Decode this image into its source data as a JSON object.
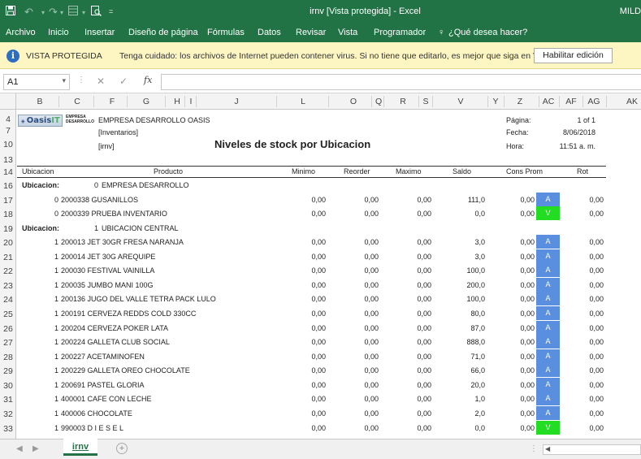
{
  "titlebar": {
    "title": "irnv  [Vista protegida]  -  Excel",
    "user": "MILD",
    "save_icon": "save-icon",
    "undo_icon": "undo-icon",
    "redo_icon": "redo-icon",
    "preview_icon": "print-preview-icon",
    "customize_icon": "customize-qat-icon"
  },
  "ribbon": {
    "tabs": [
      "Archivo",
      "Inicio",
      "Insertar",
      "Diseño de página",
      "Fórmulas",
      "Datos",
      "Revisar",
      "Vista",
      "Programador",
      "¿Qué desea hacer?"
    ]
  },
  "protected_view": {
    "label": "VISTA PROTEGIDA",
    "message": "Tenga cuidado: los archivos de Internet pueden contener virus. Si no tiene que editarlo, es mejor que siga en Vista protegida.",
    "button": "Habilitar edición",
    "icon": "info-icon"
  },
  "formula_bar": {
    "name_box": "A1",
    "fx": "fx",
    "cancel": "✕",
    "enter": "✓",
    "formula": ""
  },
  "columns": [
    "B",
    "C",
    "F",
    "G",
    "H",
    "I",
    "J",
    "L",
    "O",
    "Q",
    "R",
    "S",
    "V",
    "Y",
    "Z",
    "AC",
    "AF",
    "AG",
    "AK"
  ],
  "rows": [
    "4",
    "7",
    "10",
    "13",
    "14",
    "16",
    "17",
    "18",
    "19",
    "20",
    "21",
    "22",
    "23",
    "24",
    "25",
    "26",
    "27",
    "28",
    "29",
    "30",
    "31",
    "32",
    "33"
  ],
  "report": {
    "logo_text": "OasisIT",
    "logo_sub": "EMPRESA DESARROLLO",
    "company": "EMPRESA DESARROLLO OASIS",
    "line2": "[Inventarios]",
    "line3": "[irnv]",
    "title": "Niveles de stock por Ubicacion",
    "pagina_label": "Página:",
    "pagina_value": "1 of 1",
    "fecha_label": "Fecha:",
    "fecha_value": "8/06/2018",
    "hora_label": "Hora:",
    "hora_value": "11:51 a. m.",
    "headers": {
      "ubicacion": "Ubicacion",
      "producto": "Producto",
      "minimo": "Minimo",
      "reorder": "Reorder",
      "maximo": "Maximo",
      "saldo": "Saldo",
      "cons_prom": "Cons Prom",
      "rot": "Rot"
    },
    "group_label": "Ubicacion:",
    "groups": [
      {
        "code": "0",
        "name": "EMPRESA DESARROLLO"
      },
      {
        "code": "1",
        "name": "UBICACION CENTRAL"
      }
    ],
    "items": [
      {
        "loc": "0",
        "producto": "2000338 GUSANILLOS",
        "minimo": "0,00",
        "reorder": "0,00",
        "maximo": "0,00",
        "saldo": "111,0",
        "cons": "0,00",
        "flag": "A",
        "rot": "0,00"
      },
      {
        "loc": "0",
        "producto": "2000339 PRUEBA INVENTARIO",
        "minimo": "0,00",
        "reorder": "0,00",
        "maximo": "0,00",
        "saldo": "0,0",
        "cons": "0,00",
        "flag": "V",
        "rot": "0,00"
      },
      {
        "loc": "1",
        "producto": "200013 JET 30GR FRESA NARANJA",
        "minimo": "0,00",
        "reorder": "0,00",
        "maximo": "0,00",
        "saldo": "3,0",
        "cons": "0,00",
        "flag": "A",
        "rot": "0,00"
      },
      {
        "loc": "1",
        "producto": "200014 JET 30G AREQUIPE",
        "minimo": "0,00",
        "reorder": "0,00",
        "maximo": "0,00",
        "saldo": "3,0",
        "cons": "0,00",
        "flag": "A",
        "rot": "0,00"
      },
      {
        "loc": "1",
        "producto": "200030 FESTIVAL VAINILLA",
        "minimo": "0,00",
        "reorder": "0,00",
        "maximo": "0,00",
        "saldo": "100,0",
        "cons": "0,00",
        "flag": "A",
        "rot": "0,00"
      },
      {
        "loc": "1",
        "producto": "200035 JUMBO MANI 100G",
        "minimo": "0,00",
        "reorder": "0,00",
        "maximo": "0,00",
        "saldo": "200,0",
        "cons": "0,00",
        "flag": "A",
        "rot": "0,00"
      },
      {
        "loc": "1",
        "producto": "200136 JUGO DEL VALLE TETRA PACK LULO",
        "minimo": "0,00",
        "reorder": "0,00",
        "maximo": "0,00",
        "saldo": "100,0",
        "cons": "0,00",
        "flag": "A",
        "rot": "0,00"
      },
      {
        "loc": "1",
        "producto": "200191 CERVEZA REDDS COLD 330CC",
        "minimo": "0,00",
        "reorder": "0,00",
        "maximo": "0,00",
        "saldo": "80,0",
        "cons": "0,00",
        "flag": "A",
        "rot": "0,00"
      },
      {
        "loc": "1",
        "producto": "200204 CERVEZA POKER LATA",
        "minimo": "0,00",
        "reorder": "0,00",
        "maximo": "0,00",
        "saldo": "87,0",
        "cons": "0,00",
        "flag": "A",
        "rot": "0,00"
      },
      {
        "loc": "1",
        "producto": "200224 GALLETA CLUB SOCIAL",
        "minimo": "0,00",
        "reorder": "0,00",
        "maximo": "0,00",
        "saldo": "888,0",
        "cons": "0,00",
        "flag": "A",
        "rot": "0,00"
      },
      {
        "loc": "1",
        "producto": "200227 ACETAMINOFEN",
        "minimo": "0,00",
        "reorder": "0,00",
        "maximo": "0,00",
        "saldo": "71,0",
        "cons": "0,00",
        "flag": "A",
        "rot": "0,00"
      },
      {
        "loc": "1",
        "producto": "200229 GALLETA OREO CHOCOLATE",
        "minimo": "0,00",
        "reorder": "0,00",
        "maximo": "0,00",
        "saldo": "66,0",
        "cons": "0,00",
        "flag": "A",
        "rot": "0,00"
      },
      {
        "loc": "1",
        "producto": "200691 PASTEL GLORIA",
        "minimo": "0,00",
        "reorder": "0,00",
        "maximo": "0,00",
        "saldo": "20,0",
        "cons": "0,00",
        "flag": "A",
        "rot": "0,00"
      },
      {
        "loc": "1",
        "producto": "400001 CAFE CON LECHE",
        "minimo": "0,00",
        "reorder": "0,00",
        "maximo": "0,00",
        "saldo": "1,0",
        "cons": "0,00",
        "flag": "A",
        "rot": "0,00"
      },
      {
        "loc": "1",
        "producto": "400006 CHOCOLATE",
        "minimo": "0,00",
        "reorder": "0,00",
        "maximo": "0,00",
        "saldo": "2,0",
        "cons": "0,00",
        "flag": "A",
        "rot": "0,00"
      },
      {
        "loc": "1",
        "producto": "990003 D I E S E L",
        "minimo": "0,00",
        "reorder": "0,00",
        "maximo": "0,00",
        "saldo": "0,0",
        "cons": "0,00",
        "flag": "V",
        "rot": "0,00"
      }
    ]
  },
  "sheet_tab": "irnv",
  "add_sheet": "+",
  "colors": {
    "excel_green": "#217346",
    "flag_a": "#5a8fe0",
    "flag_v": "#22dd22",
    "protected_bar": "#fdf6c3"
  }
}
